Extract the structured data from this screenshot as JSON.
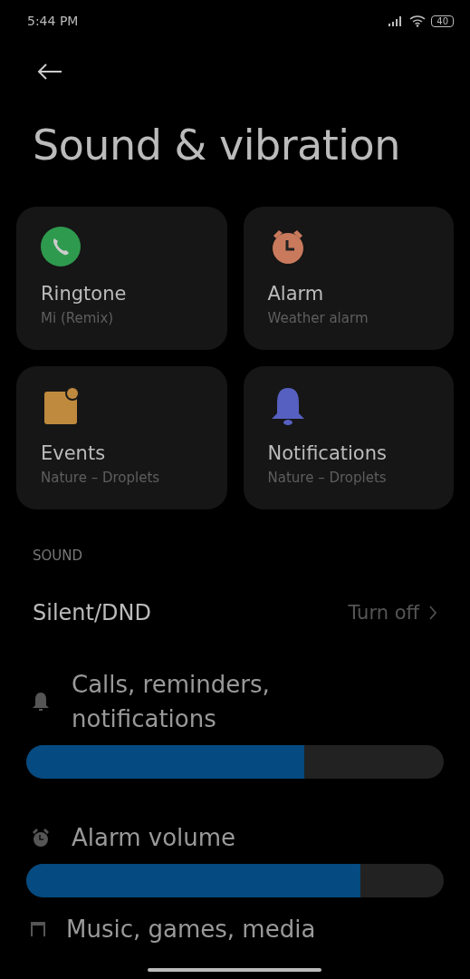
{
  "status_bar": {
    "time": "5:44 PM",
    "battery": "40"
  },
  "title": "Sound & vibration",
  "cards": [
    {
      "kind": "phone",
      "title": "Ringtone",
      "subtitle": "Mi (Remix)"
    },
    {
      "kind": "alarm",
      "title": "Alarm",
      "subtitle": "Weather alarm"
    },
    {
      "kind": "event",
      "title": "Events",
      "subtitle": "Nature – Droplets"
    },
    {
      "kind": "bell",
      "title": "Notifications",
      "subtitle": "Nature – Droplets"
    }
  ],
  "section": "SOUND",
  "silent": {
    "label": "Silent/DND",
    "value": "Turn off"
  },
  "volumes": [
    {
      "kind": "bell",
      "label": "Calls, reminders, notifications",
      "level": 0.666
    },
    {
      "kind": "alarm",
      "label": "Alarm volume",
      "level": 0.8
    },
    {
      "kind": "media",
      "label": "Music, games, media"
    }
  ]
}
